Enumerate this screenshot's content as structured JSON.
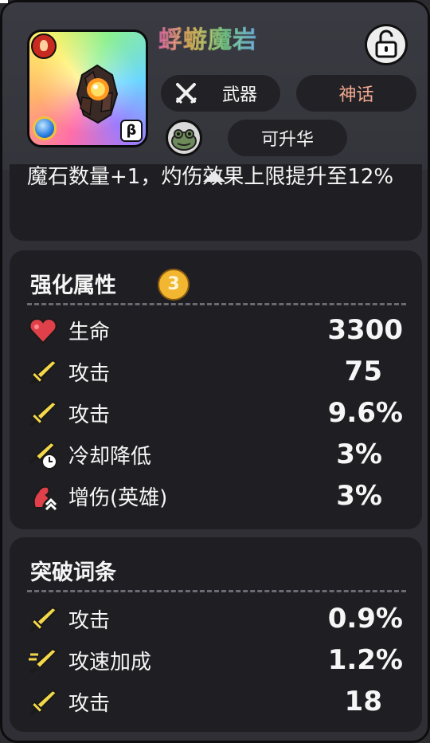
{
  "item": {
    "name": "蜉蝣魔岩",
    "type_label": "武器",
    "rarity_label": "神话",
    "sublimate_label": "可升华",
    "beta_mark": "β"
  },
  "description": {
    "partial_text": "魔石数量+1，灼伤效果上限提升至12%"
  },
  "enhance": {
    "title": "强化属性",
    "level": "3",
    "rows": [
      {
        "icon": "heart-icon",
        "label": "生命",
        "value": "3300"
      },
      {
        "icon": "sword-icon",
        "label": "攻击",
        "value": "75"
      },
      {
        "icon": "sword-icon",
        "label": "攻击",
        "value": "9.6%"
      },
      {
        "icon": "cooldown-icon",
        "label": "冷却降低",
        "value": "3%"
      },
      {
        "icon": "hero-damage-icon",
        "label": "增伤(英雄)",
        "value": "3%"
      }
    ]
  },
  "breakthrough": {
    "title": "突破词条",
    "rows": [
      {
        "icon": "sword-icon",
        "label": "攻击",
        "value": "0.9%"
      },
      {
        "icon": "attack-speed-icon",
        "label": "攻速加成",
        "value": "1.2%"
      },
      {
        "icon": "sword-icon",
        "label": "攻击",
        "value": "18"
      }
    ]
  },
  "colors": {
    "card_bg": "#1f1f23",
    "rarity_text": "#f4a890",
    "level_badge": "#f2b630",
    "sword_yellow": "#f4d84a",
    "heart_red": "#e0404a"
  }
}
